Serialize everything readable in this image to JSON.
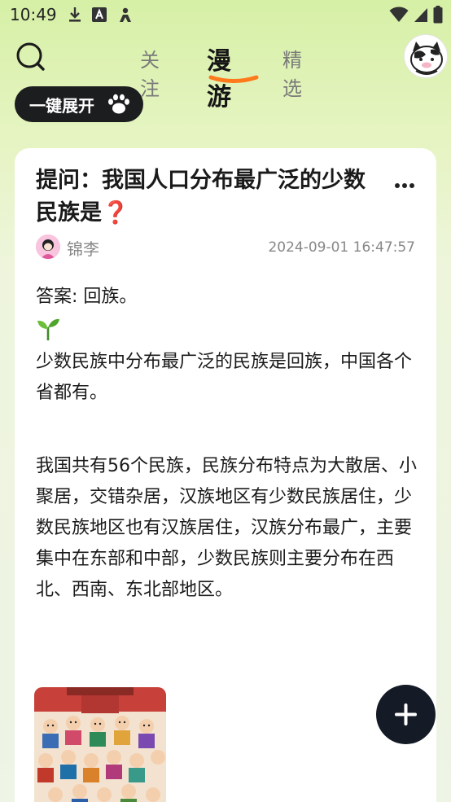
{
  "status_bar": {
    "time": "10:49",
    "icons_left": [
      "download-icon",
      "a-notification-icon",
      "person-notification-icon"
    ],
    "icons_right": [
      "wifi-icon",
      "signal-icon",
      "battery-icon"
    ]
  },
  "nav": {
    "tabs": [
      "关注",
      "漫游",
      "精选"
    ],
    "active_tab": "漫游",
    "accent_color": "#ff7a1a"
  },
  "expand_button": {
    "label": "一键展开"
  },
  "post": {
    "title": "提问：我国人口分布最广泛的少数民族是❓",
    "author": "锦李",
    "time": "2024-09-01 16:47:57",
    "answer": "答案: 回族。",
    "sprout": "🌱",
    "paragraph1": "少数民族中分布最广泛的民族是回族，中国各个省都有。",
    "paragraph2": "我国共有56个民族，民族分布特点为大散居、小聚居，交错杂居，汉族地区有少数民族居住，少数民族地区也有汉族居住，汉族分布最广，主要集中在东部和中部，少数民族则主要分布在西北、西南、东北部地区。"
  },
  "fab": {
    "icon": "plus-icon"
  }
}
